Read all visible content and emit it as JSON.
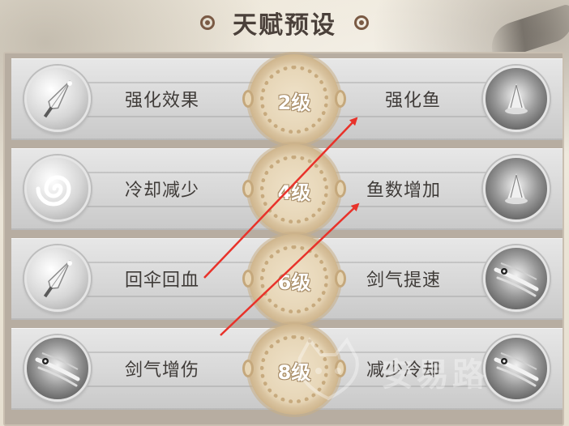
{
  "header": {
    "title": "天赋预设"
  },
  "rows": [
    {
      "left_label": "强化效果",
      "level": "2级",
      "right_label": "强化鱼",
      "left_icon": "umbrella-icon",
      "right_icon": "fish-orb-icon"
    },
    {
      "left_label": "冷却减少",
      "level": "4级",
      "right_label": "鱼数增加",
      "left_icon": "swirl-cooldown-icon",
      "right_icon": "fish-orb-icon"
    },
    {
      "left_label": "回伞回血",
      "level": "6级",
      "right_label": "剑气提速",
      "left_icon": "umbrella-icon",
      "right_icon": "sword-qi-icon"
    },
    {
      "left_label": "剑气增伤",
      "level": "8级",
      "right_label": "减少冷却",
      "left_icon": "sword-qi-icon",
      "right_icon": "sword-qi-icon"
    }
  ],
  "annotations": {
    "arrow_color": "#e8322a"
  },
  "watermark": {
    "text": "安易路"
  }
}
